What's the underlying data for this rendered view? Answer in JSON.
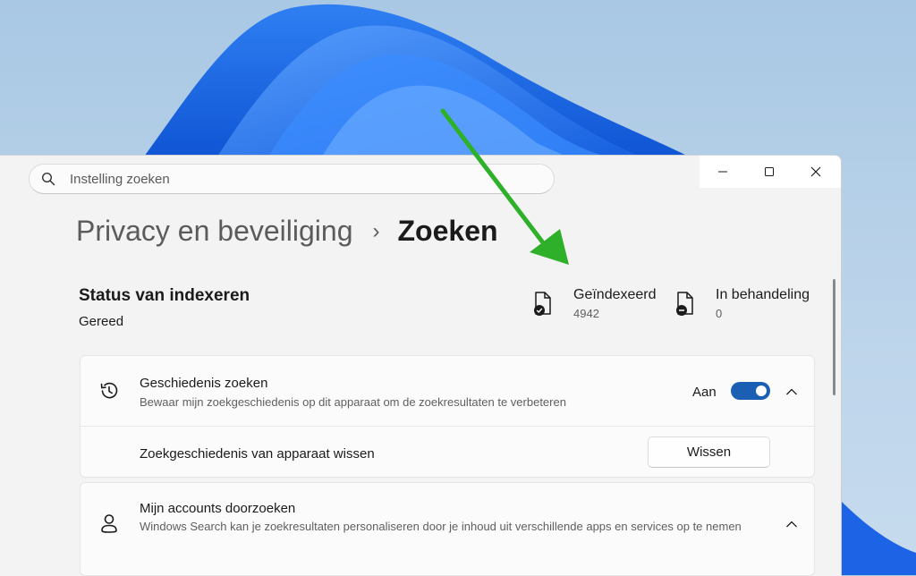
{
  "window": {
    "search": {
      "placeholder": "Instelling zoeken"
    },
    "controls": {
      "minimize": "minimize-icon",
      "maximize": "maximize-icon",
      "close": "close-icon"
    }
  },
  "breadcrumb": {
    "parent": "Privacy en beveiliging",
    "separator": "›",
    "current": "Zoeken"
  },
  "indexing": {
    "title": "Status van indexeren",
    "status": "Gereed",
    "indexed": {
      "label": "Geïndexeerd",
      "count": "4942",
      "icon": "indexed-file-icon"
    },
    "pending": {
      "label": "In behandeling",
      "count": "0",
      "icon": "pending-file-icon"
    }
  },
  "history": {
    "title": "Geschiedenis zoeken",
    "description": "Bewaar mijn zoekgeschiedenis op dit apparaat om de zoekresultaten te verbeteren",
    "toggle_label": "Aan",
    "toggle_on": true,
    "clear_label": "Zoekgeschiedenis van apparaat wissen",
    "clear_button": "Wissen",
    "icon": "history-icon"
  },
  "accounts": {
    "title": "Mijn accounts doorzoeken",
    "description": "Windows Search kan je zoekresultaten personaliseren door je inhoud uit verschillende apps en services op te nemen",
    "icon": "person-icon"
  },
  "colors": {
    "accent": "#1a5fb4",
    "annotation_arrow": "#2fb02a"
  }
}
